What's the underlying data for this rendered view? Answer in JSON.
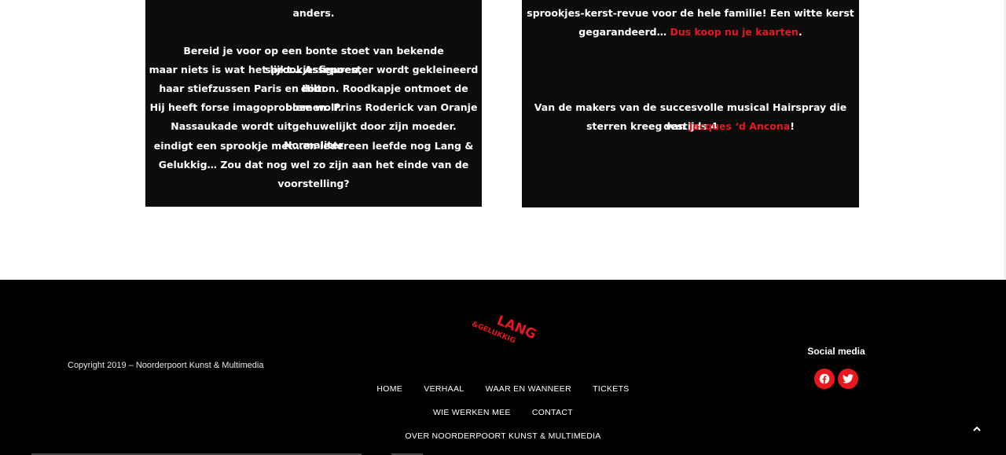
{
  "left_card": {
    "line_top": "anders.",
    "lines": [
      "Bereid je voor op een bonte stoet van bekende sprookjesfiguren,",
      "maar niets is wat het lijkt… Assepoester wordt gekleineerd door",
      "haar stiefzussen Paris en Hilton. Roodkapje ontmoet de boze wolf.",
      "Hij heeft forse imagoproblemen. Prins Roderick van Oranje",
      "Nassaukade wordt uitgehuwelijkt door zijn moeder. Normaliter",
      "eindigt een sprookje met…en iedereen leefde nog Lang &",
      "Gelukkig… Zou dat nog wel zo zijn aan het einde van de",
      "voorstelling?"
    ]
  },
  "right_card": {
    "line_top": "sprookjes-kerst-revue voor de hele familie! Een witte kerst",
    "line2_prefix": "gegarandeerd… ",
    "line2_link": "Dus koop nu je kaarten",
    "line2_suffix": ".",
    "line3": "Van de makers van de succesvolle musical Hairspray die destijds 4",
    "line4_prefix": "sterren kreeg van ",
    "line4_link": "Jacques ‘d Ancona",
    "line4_suffix": "!"
  },
  "footer": {
    "copyright": "Copyright 2019 – Noorderpoort Kunst & Multimedia",
    "logo": {
      "word1": "LANG",
      "word2": "&GELUKKIG",
      "icon": "lang-gelukkig-logo"
    },
    "nav": {
      "home": "HOME",
      "verhaal": "VERHAAL",
      "waar_en_wanneer": "WAAR EN WANNEER",
      "tickets": "TICKETS",
      "wie_werken_mee": "WIE WERKEN MEE",
      "contact": "CONTACT",
      "over": "OVER NOORDERPOORT KUNST & MULTIMEDIA"
    },
    "social_title": "Social media",
    "social_icons": [
      "facebook-icon",
      "twitter-icon"
    ],
    "scroll_top_icon": "chevron-up-icon"
  },
  "colors": {
    "accent": "#e8171f",
    "card_bg": "#0c0c0c",
    "footer_bg": "#000000"
  }
}
